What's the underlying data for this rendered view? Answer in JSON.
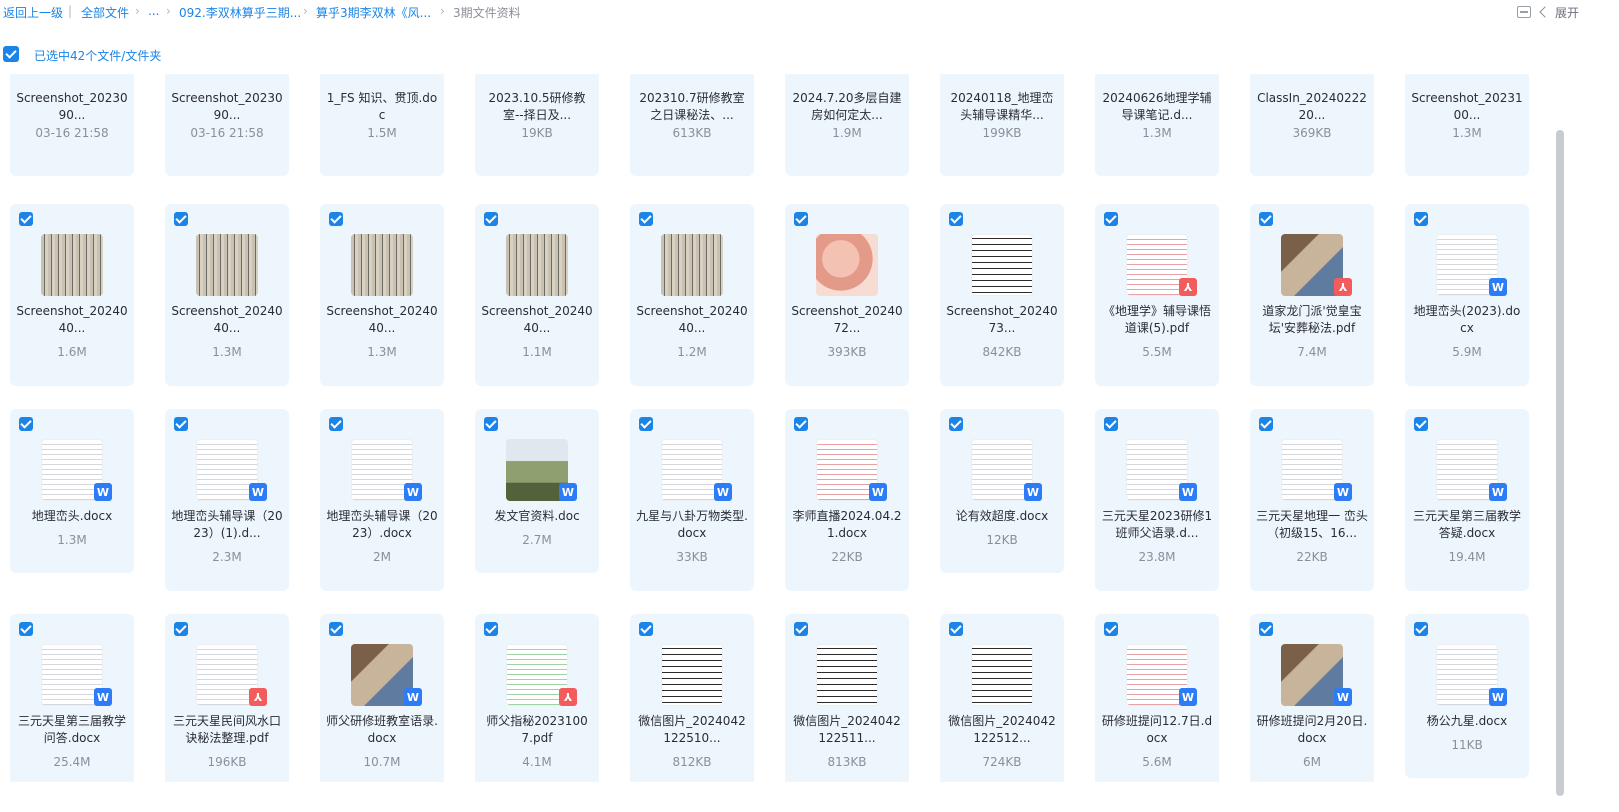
{
  "breadcrumb": {
    "back": "返回上一级",
    "all": "全部文件",
    "ellipsis": "...",
    "c1": "092.李双林算乎三期...",
    "c2": "算乎3期李双林《风...",
    "current": "3期文件资料"
  },
  "toolbar": {
    "expand": "展开"
  },
  "selection": {
    "text": "已选中42个文件/文件夹"
  },
  "files": [
    {
      "name": "Screenshot_2023090...",
      "meta": "03-16 21:58"
    },
    {
      "name": "Screenshot_2023090...",
      "meta": "03-16 21:58"
    },
    {
      "name": "1_FS 知识、贯顶.doc",
      "meta": "1.5M"
    },
    {
      "name": "2023.10.5研修教室--择日及...",
      "meta": "19KB"
    },
    {
      "name": "202310.7研修教室之日课秘法、...",
      "meta": "613KB"
    },
    {
      "name": "2024.7.20多层自建房如何定太...",
      "meta": "1.9M"
    },
    {
      "name": "20240118_地理峦头辅导课精华...",
      "meta": "199KB"
    },
    {
      "name": "20240626地理学辅导课笔记.d...",
      "meta": "1.3M"
    },
    {
      "name": "ClassIn_2024022220...",
      "meta": "369KB"
    },
    {
      "name": "Screenshot_2023100...",
      "meta": "1.3M"
    },
    {
      "name": "Screenshot_2024040...",
      "meta": "1.6M"
    },
    {
      "name": "Screenshot_2024040...",
      "meta": "1.3M"
    },
    {
      "name": "Screenshot_2024040...",
      "meta": "1.3M"
    },
    {
      "name": "Screenshot_2024040...",
      "meta": "1.1M"
    },
    {
      "name": "Screenshot_2024040...",
      "meta": "1.2M"
    },
    {
      "name": "Screenshot_2024072...",
      "meta": "393KB"
    },
    {
      "name": "Screenshot_2024073...",
      "meta": "842KB"
    },
    {
      "name": "《地理学》辅导课悟道课(5).pdf",
      "meta": "5.5M"
    },
    {
      "name": "道家龙门派'觉皇宝坛'安葬秘法.pdf",
      "meta": "7.4M"
    },
    {
      "name": "地理峦头(2023).docx",
      "meta": "5.9M"
    },
    {
      "name": "地理峦头.docx",
      "meta": "1.3M"
    },
    {
      "name": "地理峦头辅导课（2023）(1).d...",
      "meta": "2.3M"
    },
    {
      "name": "地理峦头辅导课（2023）.docx",
      "meta": "2M"
    },
    {
      "name": "发文官资料.doc",
      "meta": "2.7M"
    },
    {
      "name": "九星与八卦万物类型.docx",
      "meta": "33KB"
    },
    {
      "name": "李师直播2024.04.21.docx",
      "meta": "22KB"
    },
    {
      "name": "论有效超度.docx",
      "meta": "12KB"
    },
    {
      "name": "三元天星2023研修1班师父语录.d...",
      "meta": "23.8M"
    },
    {
      "name": "三元天星地理一 峦头（初级15、16...",
      "meta": "22KB"
    },
    {
      "name": "三元天星第三届教学答疑.docx",
      "meta": "19.4M"
    },
    {
      "name": "三元天星第三届教学问答.docx",
      "meta": "25.4M"
    },
    {
      "name": "三元天星民间风水口诀秘法整理.pdf",
      "meta": "196KB"
    },
    {
      "name": "师父研修班教室语录.docx",
      "meta": "10.7M"
    },
    {
      "name": "师父指秘20231007.pdf",
      "meta": "4.1M"
    },
    {
      "name": "微信图片_2024042122510...",
      "meta": "812KB"
    },
    {
      "name": "微信图片_2024042122511...",
      "meta": "813KB"
    },
    {
      "name": "微信图片_2024042122512...",
      "meta": "724KB"
    },
    {
      "name": "研修班提问12.7日.docx",
      "meta": "5.6M"
    },
    {
      "name": "研修班提问2月20日.docx",
      "meta": "6M"
    },
    {
      "name": "杨公九星.docx",
      "meta": "11KB"
    }
  ]
}
